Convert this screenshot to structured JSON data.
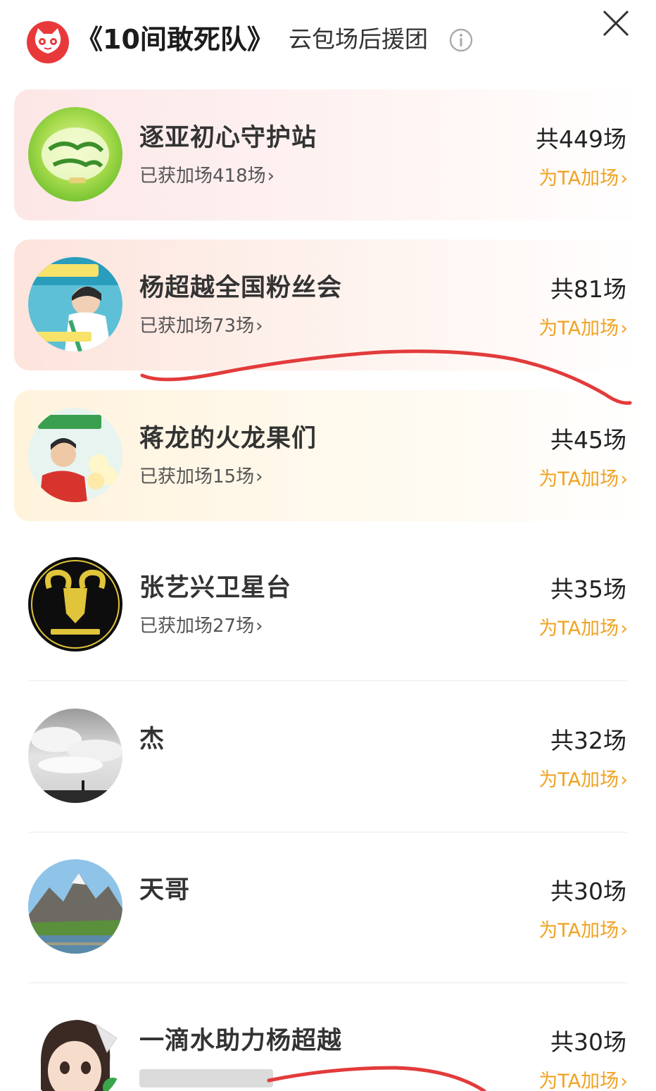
{
  "header": {
    "title_main": "《10间敢死队》",
    "title_sub": "云包场后援团",
    "info_icon": "info-icon",
    "close_icon": "close-icon"
  },
  "colors": {
    "accent_orange": "#f0a323",
    "brand_red": "#e8393a",
    "annotation_red": "#e23b3b"
  },
  "rows": [
    {
      "name": "逐亚初心守护站",
      "got": "已获加场418场",
      "total": "共449场",
      "add": "为TA加场",
      "chev": "›"
    },
    {
      "name": "杨超越全国粉丝会",
      "got": "已获加场73场",
      "total": "共81场",
      "add": "为TA加场",
      "chev": "›"
    },
    {
      "name": "蒋龙的火龙果们",
      "got": "已获加场15场",
      "total": "共45场",
      "add": "为TA加场",
      "chev": "›"
    },
    {
      "name": "张艺兴卫星台",
      "got": "已获加场27场",
      "total": "共35场",
      "add": "为TA加场",
      "chev": "›"
    },
    {
      "name": "杰",
      "got": "",
      "total": "共32场",
      "add": "为TA加场",
      "chev": "›"
    },
    {
      "name": "天哥",
      "got": "",
      "total": "共30场",
      "add": "为TA加场",
      "chev": "›"
    },
    {
      "name": "一滴水助力杨超越",
      "got": "",
      "total": "共30场",
      "add": "为TA加场",
      "chev": "›"
    }
  ]
}
